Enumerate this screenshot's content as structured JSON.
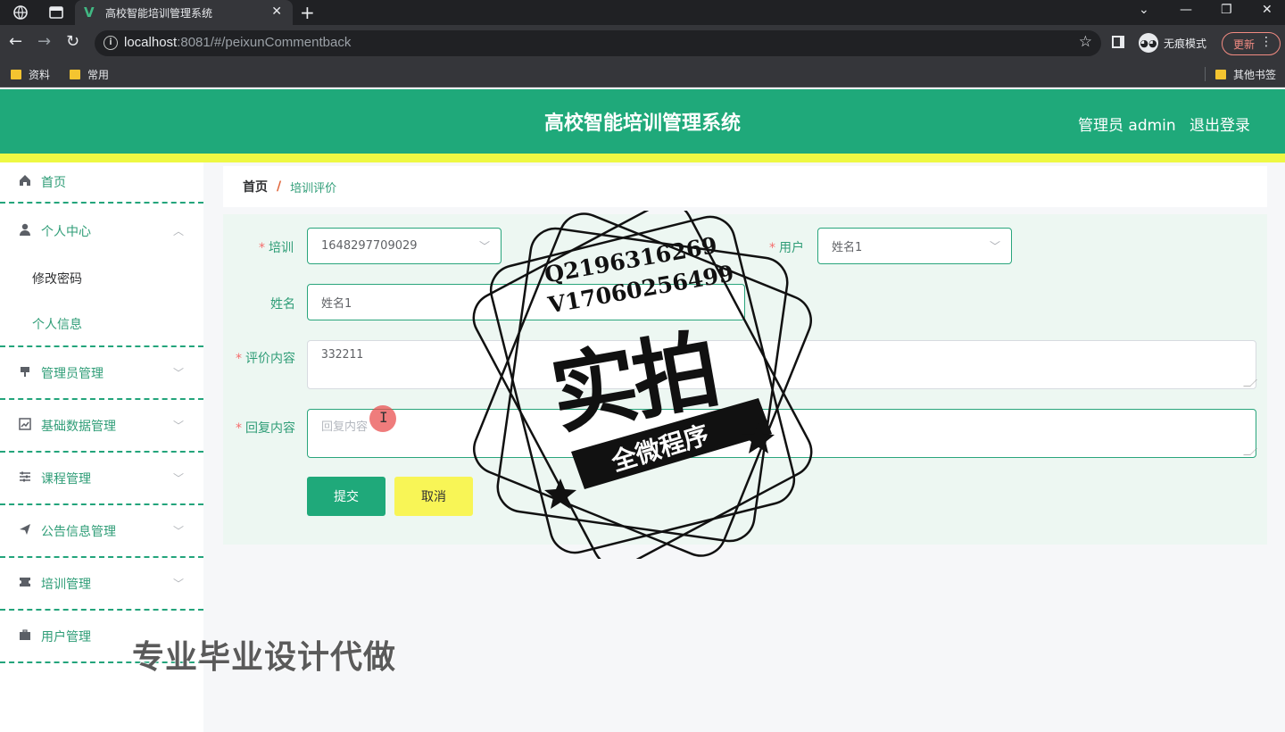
{
  "browser": {
    "tab_title": "高校智能培训管理系统",
    "tab_logo": "V",
    "url_host": "localhost",
    "url_rest": ":8081/#/peixunCommentback",
    "incognito_label": "无痕模式",
    "update_label": "更新",
    "bookmarks": [
      "资料",
      "常用"
    ],
    "other_bookmarks": "其他书签"
  },
  "header": {
    "title": "高校智能培训管理系统",
    "admin": "管理员 admin",
    "logout": "退出登录",
    "color": "#1fa97a",
    "strip_color": "#eef843"
  },
  "sidebar": {
    "home": "首页",
    "personal_center": "个人中心",
    "change_password": "修改密码",
    "personal_info": "个人信息",
    "items": [
      "管理员管理",
      "基础数据管理",
      "课程管理",
      "公告信息管理",
      "培训管理",
      "用户管理"
    ]
  },
  "breadcrumb": {
    "home": "首页",
    "separator": "/",
    "current": "培训评价"
  },
  "form": {
    "training_label": "培训",
    "training_value": "1648297709029",
    "user_label": "用户",
    "user_value": "姓名1",
    "name_label": "姓名",
    "name_value": "姓名1",
    "comment_label": "评价内容",
    "comment_value": "332211",
    "reply_label": "回复内容",
    "reply_placeholder": "回复内容",
    "submit": "提交",
    "cancel": "取消"
  },
  "watermark": {
    "line1": "Q2196316269",
    "line2": "V17060256499",
    "big": "实拍",
    "banner": "全微程序",
    "overlay": "专业毕业设计代做"
  }
}
